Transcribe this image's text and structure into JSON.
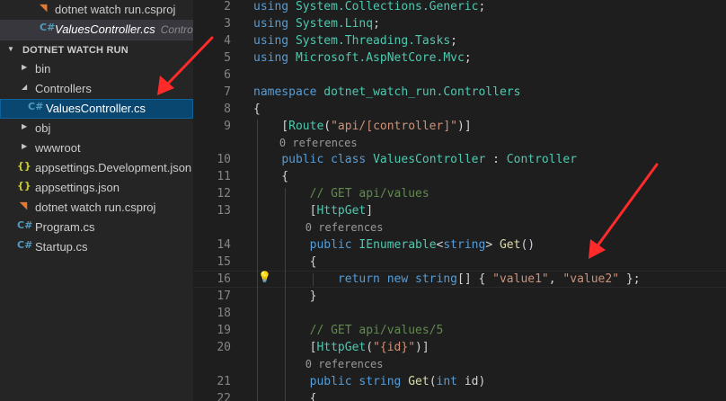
{
  "open_editors": [
    {
      "name": "dotnet watch run.csproj",
      "description": "",
      "icon": "rss-icon",
      "active": false
    },
    {
      "name": "ValuesController.cs",
      "description": "Controllers",
      "icon": "csharp-icon",
      "active": true
    }
  ],
  "explorer": {
    "section_title": "DOTNET WATCH RUN",
    "items": [
      {
        "label": "bin",
        "type": "folder",
        "expanded": false,
        "depth": 1
      },
      {
        "label": "Controllers",
        "type": "folder",
        "expanded": true,
        "depth": 1
      },
      {
        "label": "ValuesController.cs",
        "type": "file",
        "icon": "csharp-icon",
        "depth": 2,
        "selected": true
      },
      {
        "label": "obj",
        "type": "folder",
        "expanded": false,
        "depth": 1
      },
      {
        "label": "wwwroot",
        "type": "folder",
        "expanded": false,
        "depth": 1
      },
      {
        "label": "appsettings.Development.json",
        "type": "file",
        "icon": "json-icon",
        "depth": 1
      },
      {
        "label": "appsettings.json",
        "type": "file",
        "icon": "json-icon",
        "depth": 1
      },
      {
        "label": "dotnet watch run.csproj",
        "type": "file",
        "icon": "rss-icon",
        "depth": 1
      },
      {
        "label": "Program.cs",
        "type": "file",
        "icon": "csharp-icon",
        "depth": 1
      },
      {
        "label": "Startup.cs",
        "type": "file",
        "icon": "csharp-icon",
        "depth": 1
      }
    ]
  },
  "editor": {
    "lines": [
      {
        "n": "2",
        "tokens": [
          [
            "kw",
            "using"
          ],
          [
            "pl",
            " "
          ],
          [
            "ty",
            "System.Collections.Generic"
          ],
          [
            "pl",
            ";"
          ]
        ]
      },
      {
        "n": "3",
        "tokens": [
          [
            "kw",
            "using"
          ],
          [
            "pl",
            " "
          ],
          [
            "ty",
            "System.Linq"
          ],
          [
            "pl",
            ";"
          ]
        ]
      },
      {
        "n": "4",
        "tokens": [
          [
            "kw",
            "using"
          ],
          [
            "pl",
            " "
          ],
          [
            "ty",
            "System.Threading.Tasks"
          ],
          [
            "pl",
            ";"
          ]
        ]
      },
      {
        "n": "5",
        "tokens": [
          [
            "kw",
            "using"
          ],
          [
            "pl",
            " "
          ],
          [
            "ty",
            "Microsoft.AspNetCore.Mvc"
          ],
          [
            "pl",
            ";"
          ]
        ]
      },
      {
        "n": "6",
        "tokens": []
      },
      {
        "n": "7",
        "tokens": [
          [
            "kw",
            "namespace"
          ],
          [
            "pl",
            " "
          ],
          [
            "ty",
            "dotnet_watch_run.Controllers"
          ]
        ]
      },
      {
        "n": "8",
        "tokens": [
          [
            "pl",
            "{"
          ]
        ]
      },
      {
        "n": "9",
        "tokens": [
          [
            "pl",
            "    ["
          ],
          [
            "ty",
            "Route"
          ],
          [
            "pl",
            "("
          ],
          [
            "st",
            "\"api/[controller]\""
          ],
          [
            "pl",
            ")]"
          ]
        ]
      },
      {
        "lens": "    0 references"
      },
      {
        "n": "10",
        "tokens": [
          [
            "pl",
            "    "
          ],
          [
            "kw",
            "public"
          ],
          [
            "pl",
            " "
          ],
          [
            "kw",
            "class"
          ],
          [
            "pl",
            " "
          ],
          [
            "ty",
            "ValuesController"
          ],
          [
            "pl",
            " : "
          ],
          [
            "ty",
            "Controller"
          ]
        ]
      },
      {
        "n": "11",
        "tokens": [
          [
            "pl",
            "    {"
          ]
        ]
      },
      {
        "n": "12",
        "tokens": [
          [
            "pl",
            "        "
          ],
          [
            "cm",
            "// GET api/values"
          ]
        ]
      },
      {
        "n": "13",
        "tokens": [
          [
            "pl",
            "        ["
          ],
          [
            "ty",
            "HttpGet"
          ],
          [
            "pl",
            "]"
          ]
        ]
      },
      {
        "lens": "        0 references"
      },
      {
        "n": "14",
        "tokens": [
          [
            "pl",
            "        "
          ],
          [
            "kw",
            "public"
          ],
          [
            "pl",
            " "
          ],
          [
            "ty",
            "IEnumerable"
          ],
          [
            "pl",
            "<"
          ],
          [
            "kw",
            "string"
          ],
          [
            "pl",
            "> "
          ],
          [
            "fn",
            "Get"
          ],
          [
            "pl",
            "()"
          ]
        ]
      },
      {
        "n": "15",
        "tokens": [
          [
            "pl",
            "        {"
          ]
        ]
      },
      {
        "n": "16",
        "tokens": [
          [
            "pl",
            "            "
          ],
          [
            "kw",
            "return"
          ],
          [
            "pl",
            " "
          ],
          [
            "kw",
            "new"
          ],
          [
            "pl",
            " "
          ],
          [
            "kw",
            "string"
          ],
          [
            "pl",
            "[] { "
          ],
          [
            "st",
            "\"value1\""
          ],
          [
            "pl",
            ", "
          ],
          [
            "st",
            "\"value2\""
          ],
          [
            "pl",
            " };"
          ]
        ]
      },
      {
        "n": "17",
        "tokens": [
          [
            "pl",
            "        }"
          ]
        ]
      },
      {
        "n": "18",
        "tokens": []
      },
      {
        "n": "19",
        "tokens": [
          [
            "pl",
            "        "
          ],
          [
            "cm",
            "// GET api/values/5"
          ]
        ]
      },
      {
        "n": "20",
        "tokens": [
          [
            "pl",
            "        ["
          ],
          [
            "ty",
            "HttpGet"
          ],
          [
            "pl",
            "("
          ],
          [
            "st",
            "\"{id}\""
          ],
          [
            "pl",
            ")]"
          ]
        ]
      },
      {
        "lens": "        0 references"
      },
      {
        "n": "21",
        "tokens": [
          [
            "pl",
            "        "
          ],
          [
            "kw",
            "public"
          ],
          [
            "pl",
            " "
          ],
          [
            "kw",
            "string"
          ],
          [
            "pl",
            " "
          ],
          [
            "fn",
            "Get"
          ],
          [
            "pl",
            "("
          ],
          [
            "kw",
            "int"
          ],
          [
            "pl",
            " id)"
          ]
        ]
      },
      {
        "n": "22",
        "tokens": [
          [
            "pl",
            "        {"
          ]
        ]
      }
    ],
    "highlighted_line": "16",
    "lightbulb_icon": "lightbulb-icon"
  },
  "colors": {
    "sidebar_bg": "#252526",
    "editor_bg": "#1e1e1e",
    "selection": "#094771",
    "annotation_arrow": "#ff2a2a"
  },
  "annotations": [
    {
      "name": "annotation-arrow-explorer",
      "points_to": "ValuesController.cs"
    },
    {
      "name": "annotation-arrow-code",
      "points_to": "return new string[] { \"value1\", \"value2\" };"
    }
  ]
}
